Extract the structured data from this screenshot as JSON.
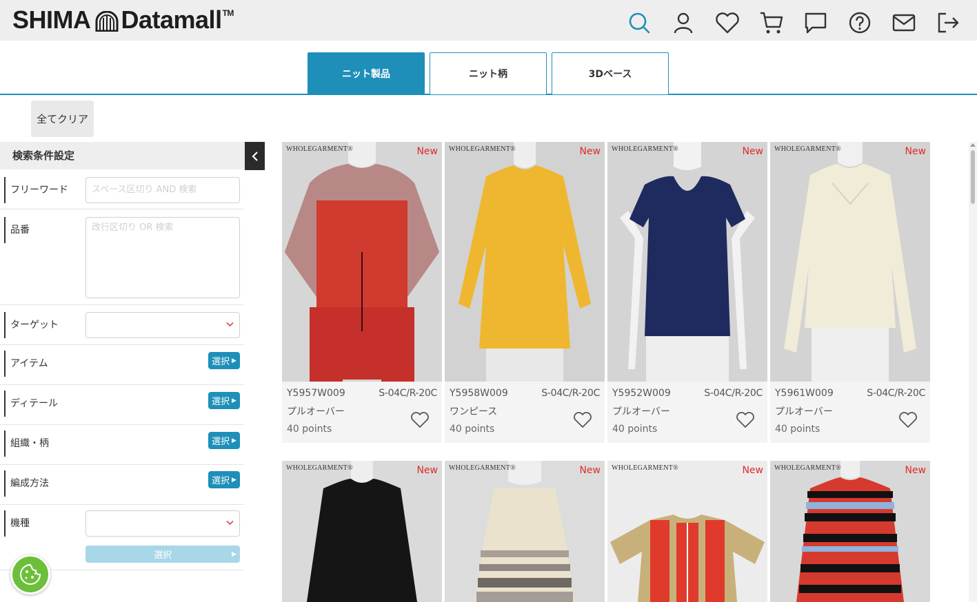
{
  "header": {
    "logo_left": "SHIMA",
    "logo_right": "Datamall",
    "logo_tm": "TM",
    "icons": [
      "search-icon",
      "user-icon",
      "heart-icon",
      "cart-icon",
      "chat-icon",
      "help-icon",
      "mail-icon",
      "logout-icon"
    ],
    "accent": "#1e8fb8"
  },
  "tabs": [
    {
      "label": "ニット製品",
      "active": true
    },
    {
      "label": "ニット柄",
      "active": false
    },
    {
      "label": "3Dベース",
      "active": false
    }
  ],
  "clear_all": "全てクリア",
  "sidebar": {
    "title": "検索条件設定",
    "freeword": {
      "label": "フリーワード",
      "placeholder": "スペース区切り AND 検索"
    },
    "item_no": {
      "label": "品番",
      "placeholder": "改行区切り OR 検索"
    },
    "target": {
      "label": "ターゲット",
      "value": ""
    },
    "item": {
      "label": "アイテム",
      "button": "選択"
    },
    "detail": {
      "label": "ディテール",
      "button": "選択"
    },
    "structure": {
      "label": "組織・柄",
      "button": "選択"
    },
    "knit_method": {
      "label": "編成方法",
      "button": "選択"
    },
    "machine": {
      "label": "機種",
      "value": "",
      "button": "選択"
    }
  },
  "products": [
    {
      "brand": "WHOLEGARMENT®",
      "badge": "New",
      "code": "Y5957W009",
      "spec": "S-04C/R-20C",
      "type": "プルオーバー",
      "points": "40 points"
    },
    {
      "brand": "WHOLEGARMENT®",
      "badge": "New",
      "code": "Y5958W009",
      "spec": "S-04C/R-20C",
      "type": "ワンピース",
      "points": "40 points"
    },
    {
      "brand": "WHOLEGARMENT®",
      "badge": "New",
      "code": "Y5952W009",
      "spec": "S-04C/R-20C",
      "type": "プルオーバー",
      "points": "40 points"
    },
    {
      "brand": "WHOLEGARMENT®",
      "badge": "New",
      "code": "Y5961W009",
      "spec": "S-04C/R-20C",
      "type": "プルオーバー",
      "points": "40 points"
    },
    {
      "brand": "WHOLEGARMENT®",
      "badge": "New"
    },
    {
      "brand": "WHOLEGARMENT®",
      "badge": "New"
    },
    {
      "brand": "WHOLEGARMENT®",
      "badge": "New"
    },
    {
      "brand": "WHOLEGARMENT®",
      "badge": "New"
    }
  ]
}
